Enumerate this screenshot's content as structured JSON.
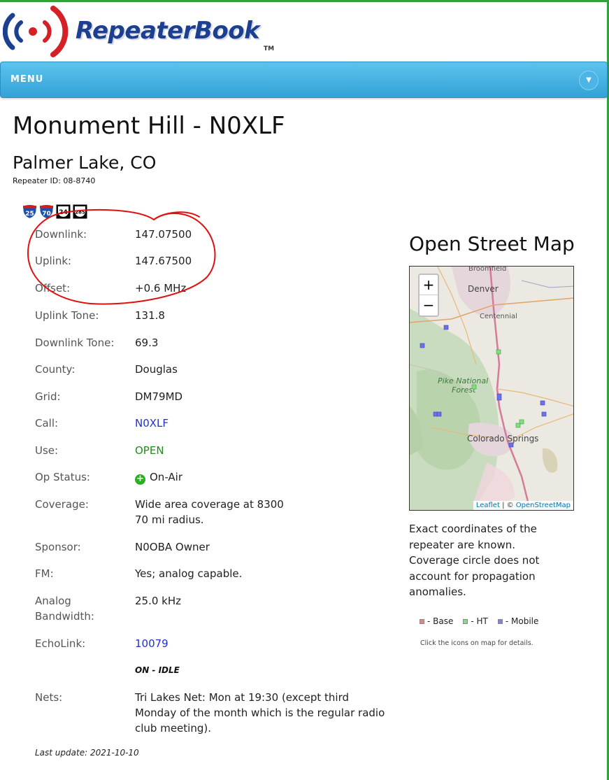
{
  "header": {
    "brand": "RepeaterBook",
    "tm": "TM",
    "menu_label": "MENU"
  },
  "repeater": {
    "title": "Monument Hill - N0XLF",
    "location": "Palmer Lake, CO",
    "repeater_id": "Repeater ID: 08-8740",
    "highways": [
      "25",
      "70",
      "24",
      "285"
    ]
  },
  "details": {
    "downlink": {
      "label": "Downlink:",
      "value": "147.07500"
    },
    "uplink": {
      "label": "Uplink:",
      "value": "147.67500"
    },
    "offset": {
      "label": "Offset:",
      "value": "+0.6 MHz"
    },
    "uplink_tone": {
      "label": "Uplink Tone:",
      "value": "131.8"
    },
    "downlink_tone": {
      "label": "Downlink Tone:",
      "value": "69.3"
    },
    "county": {
      "label": "County:",
      "value": "Douglas"
    },
    "grid": {
      "label": "Grid:",
      "value": "DM79MD"
    },
    "call": {
      "label": "Call:",
      "value": "N0XLF"
    },
    "use": {
      "label": "Use:",
      "value": "OPEN"
    },
    "op_status": {
      "label": "Op Status:",
      "value": "On-Air",
      "icon": "+"
    },
    "coverage": {
      "label": "Coverage:",
      "value": "Wide area coverage at 8300",
      "value2": "70 mi radius."
    },
    "sponsor": {
      "label": "Sponsor:",
      "value": "N0OBA Owner"
    },
    "fm": {
      "label": "FM:",
      "value": "Yes; analog capable."
    },
    "analog_bw": {
      "label": "Analog Bandwidth:",
      "value": "25.0 kHz"
    },
    "echolink": {
      "label": "EchoLink:",
      "value": "10079",
      "status": "ON - IDLE"
    },
    "nets": {
      "label": "Nets:",
      "value": "Tri Lakes Net: Mon at 19:30 (except third Monday of the month which is the regular radio club meeting)."
    },
    "last_update": "Last update: 2021-10-10"
  },
  "map": {
    "title": "Open Street Map",
    "zoom_in": "+",
    "zoom_out": "−",
    "labels": {
      "broomfield": "Broomfield",
      "denver": "Denver",
      "centennial": "Centennial",
      "forest1": "Pike National",
      "forest2": "Forest",
      "springs": "Colorado Springs"
    },
    "attribution_leaflet": "Leaflet",
    "attribution_sep": " | © ",
    "attribution_osm": "OpenStreetMap",
    "note": "Exact coordinates of the repeater are known. Coverage circle does not account for propagation anomalies.",
    "legend": [
      {
        "label": "- Base",
        "color": "#f08080"
      },
      {
        "label": "- HT",
        "color": "#7fe07f"
      },
      {
        "label": "- Mobile",
        "color": "#7f7ff0"
      }
    ],
    "hint": "Click the icons on map for details."
  },
  "colors": {
    "menu": "#32a2d7",
    "brand_blue": "#1c3f8f",
    "brand_red": "#d42026",
    "link": "#2230d0",
    "open": "#218c1e",
    "annotation": "#e01010"
  }
}
